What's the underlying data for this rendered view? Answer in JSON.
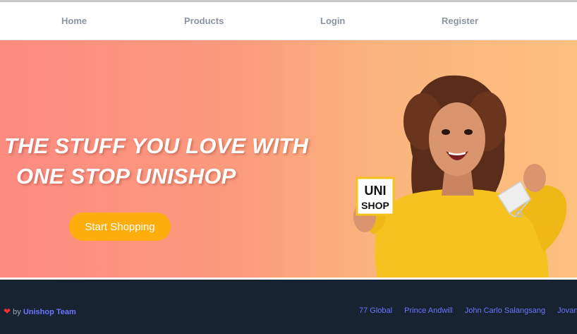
{
  "nav": {
    "home": "Home",
    "products": "Products",
    "login": "Login",
    "register": "Register"
  },
  "hero": {
    "headline_line1": "THE STUFF YOU LOVE WITH",
    "headline_line2": "ONE STOP UNISHOP",
    "cta_label": "Start Shopping",
    "card_text_line1": "UNI",
    "card_text_line2": "SHOP"
  },
  "footer": {
    "by_text": "by",
    "team_link": "Unishop Team",
    "links": [
      "77 Global",
      "Prince Andwill",
      "John Carlo Salangsang",
      "Jovanie"
    ]
  },
  "colors": {
    "nav_text": "#8a93a3",
    "cta": "#fdae0c",
    "footer_bg": "#172331",
    "link": "#6a76ff",
    "heart": "#ee3030"
  },
  "icons": {
    "heart": "heart-icon",
    "bag": "shopping-bag-icon"
  }
}
